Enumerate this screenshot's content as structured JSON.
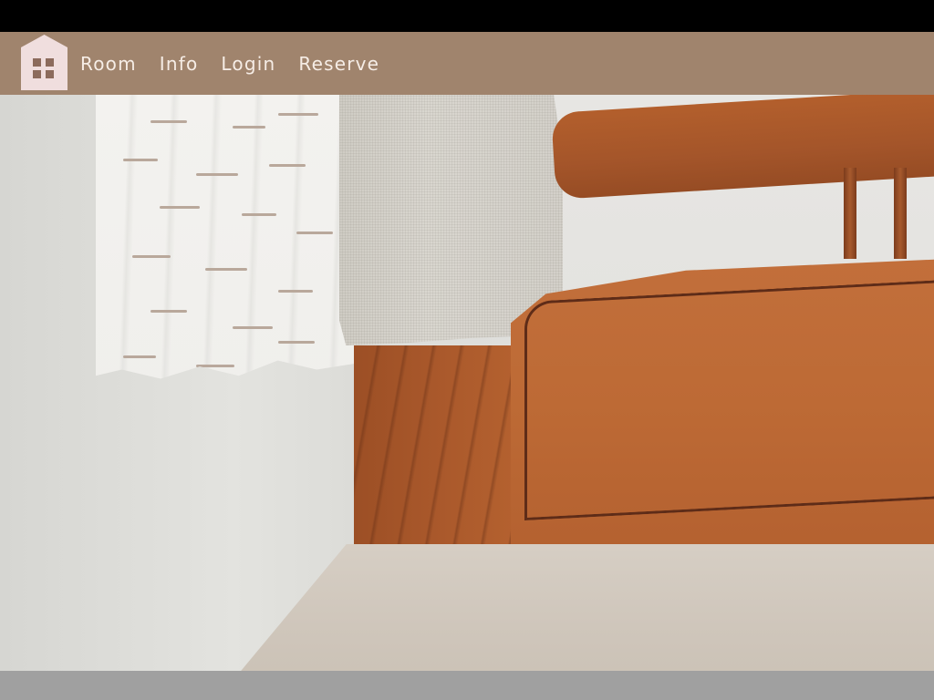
{
  "nav": {
    "logo_icon": "house-icon",
    "links": [
      "Room",
      "Info",
      "Login",
      "Reserve"
    ]
  },
  "hero": {
    "image_subject": "bedroom-photo"
  },
  "colors": {
    "nav_background": "#a0846d",
    "nav_text": "#f6ede6",
    "logo_fill": "#f0dede",
    "logo_window": "#8c6b5c"
  }
}
